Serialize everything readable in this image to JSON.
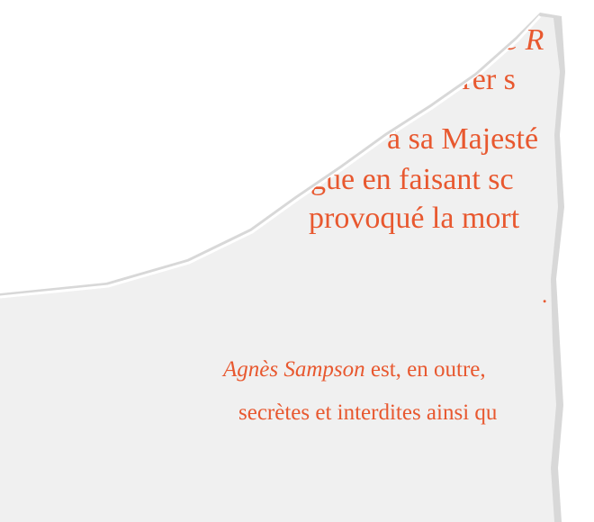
{
  "fragment": {
    "colors": {
      "text": "#e8582f",
      "paper": "#f0f0f0",
      "background": "#ffffff",
      "torn_edge": "#dcdcdc"
    },
    "lines": [
      {
        "text": "e R"
      },
      {
        "text": "mbrer s"
      },
      {
        "text": "à sa Majesté"
      },
      {
        "text": "gue en faisant sc"
      },
      {
        "text": "provoqué la mort"
      },
      {
        "text": "."
      }
    ],
    "paragraph": {
      "name_italic": "Agnès Sampson",
      "line1_rest": " est, en outre,",
      "line2": "secrètes et interdites ainsi qu"
    }
  }
}
